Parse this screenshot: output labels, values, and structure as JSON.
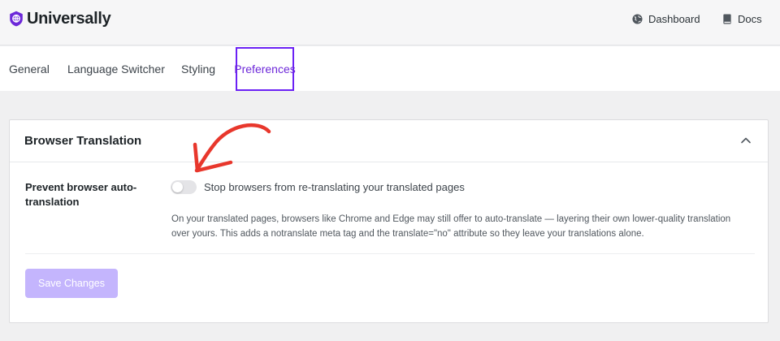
{
  "app": {
    "name": "Universally",
    "logo_icon": "universally-logo-icon",
    "brand_color": "#6d28d9"
  },
  "header": {
    "links": [
      {
        "label": "Dashboard",
        "icon": "globe-icon"
      },
      {
        "label": "Docs",
        "icon": "book-icon"
      }
    ]
  },
  "tabs": [
    {
      "label": "General",
      "active": false
    },
    {
      "label": "Language Switcher",
      "active": false
    },
    {
      "label": "Styling",
      "active": false
    },
    {
      "label": "Preferences",
      "active": true
    }
  ],
  "section": {
    "title": "Browser Translation",
    "collapse_icon": "chevron-up-icon",
    "setting": {
      "label": "Prevent browser auto-translation",
      "toggle_on": false,
      "toggle_text": "Stop browsers from re-translating your translated pages",
      "help_line1": "On your translated pages, browsers like Chrome and Edge may still offer to auto-translate — layering their own lower-quality translation",
      "help_line2": "over yours. This adds a notranslate meta tag and the translate=\"no\" attribute so they leave your translations alone."
    },
    "save_label": "Save Changes"
  },
  "annotation": {
    "type": "red-arrow",
    "color": "#e8372c"
  }
}
